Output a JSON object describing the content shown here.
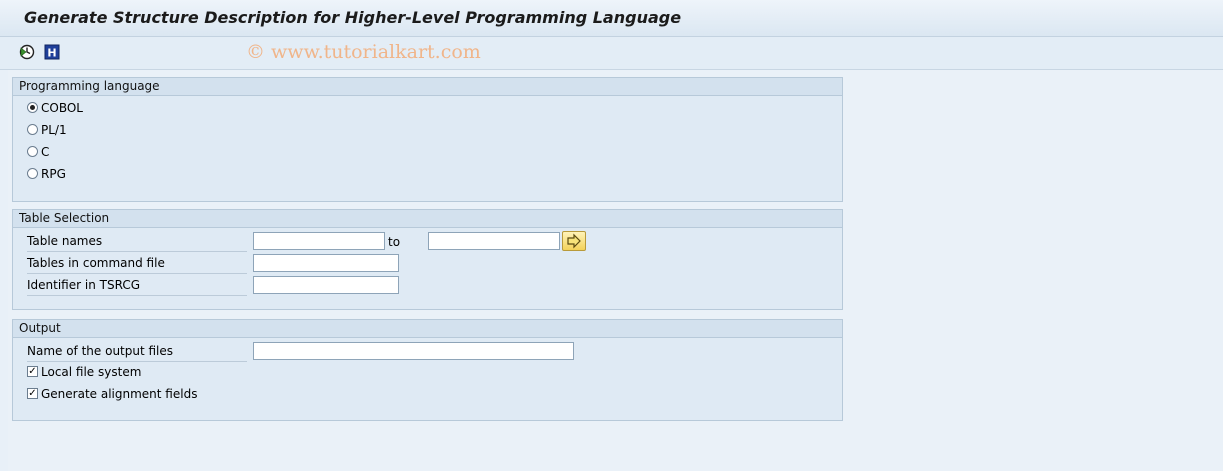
{
  "title": "Generate Structure Description for Higher-Level Programming Language",
  "toolbar": {
    "execute_icon": "execute-clock-icon",
    "info_icon": "information-icon",
    "info_glyph": "H"
  },
  "watermark": "© www.tutorialkart.com",
  "programming_language": {
    "header": "Programming language",
    "options": [
      {
        "label": "COBOL",
        "selected": true
      },
      {
        "label": "PL/1",
        "selected": false
      },
      {
        "label": "C",
        "selected": false
      },
      {
        "label": "RPG",
        "selected": false
      }
    ]
  },
  "table_selection": {
    "header": "Table Selection",
    "table_names_label": "Table names",
    "table_names_from": "",
    "to_label": "to",
    "table_names_to": "",
    "command_file_label": "Tables in command file",
    "command_file_value": "",
    "identifier_label": "Identifier in TSRCG",
    "identifier_value": "",
    "range_icon": "arrow-right-icon"
  },
  "output": {
    "header": "Output",
    "output_files_label": "Name of the output files",
    "output_files_value": "",
    "local_fs_label": "Local file system",
    "local_fs_checked": true,
    "alignment_label": "Generate alignment fields",
    "alignment_checked": true
  },
  "colors": {
    "background": "#e8f0f8",
    "group_bg": "#dfeaf4",
    "watermark": "#f0b58a",
    "button_yellow": "#f3d25a"
  }
}
